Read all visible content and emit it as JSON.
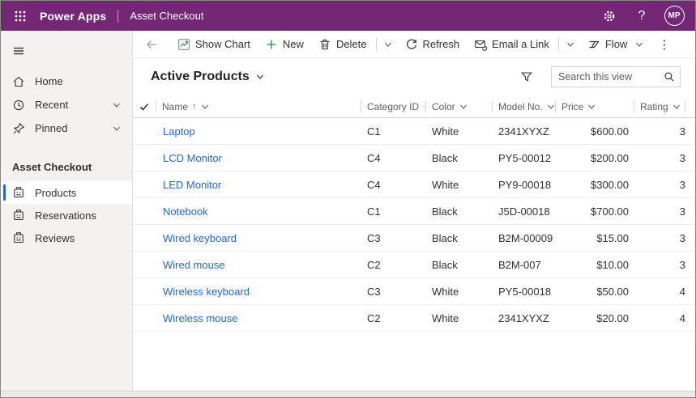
{
  "titlebar": {
    "app_name": "Power Apps",
    "app_context": "Asset Checkout",
    "avatar_initials": "MP",
    "background_color": "#742774"
  },
  "sidebar": {
    "nav": [
      {
        "label": "Home",
        "icon": "home-icon",
        "expandable": false
      },
      {
        "label": "Recent",
        "icon": "clock-icon",
        "expandable": true
      },
      {
        "label": "Pinned",
        "icon": "pin-icon",
        "expandable": true
      }
    ],
    "section_title": "Asset Checkout",
    "entities": [
      {
        "label": "Products",
        "icon": "product-icon",
        "selected": true
      },
      {
        "label": "Reservations",
        "icon": "product-icon",
        "selected": false
      },
      {
        "label": "Reviews",
        "icon": "product-icon",
        "selected": false
      }
    ]
  },
  "toolbar": {
    "show_chart_label": "Show Chart",
    "new_label": "New",
    "delete_label": "Delete",
    "refresh_label": "Refresh",
    "email_link_label": "Email a Link",
    "flow_label": "Flow",
    "more_glyph": "⋮",
    "new_plus_color": "#2E9C46"
  },
  "view": {
    "title": "Active Products",
    "search_placeholder": "Search this view"
  },
  "grid": {
    "columns": [
      {
        "label": "Name",
        "sorted": "ascending"
      },
      {
        "label": "Category ID"
      },
      {
        "label": "Color"
      },
      {
        "label": "Model No."
      },
      {
        "label": "Price"
      },
      {
        "label": "Rating"
      }
    ],
    "rows": [
      {
        "name": "Laptop",
        "category_id": "C1",
        "color": "White",
        "model_no": "2341XYXZ",
        "price": "$600.00",
        "rating": "3"
      },
      {
        "name": "LCD Monitor",
        "category_id": "C4",
        "color": "Black",
        "model_no": "PY5-00012",
        "price": "$200.00",
        "rating": "3"
      },
      {
        "name": "LED Monitor",
        "category_id": "C4",
        "color": "White",
        "model_no": "PY9-00018",
        "price": "$300.00",
        "rating": "3"
      },
      {
        "name": "Notebook",
        "category_id": "C1",
        "color": "Black",
        "model_no": "J5D-00018",
        "price": "$700.00",
        "rating": "3"
      },
      {
        "name": "Wired keyboard",
        "category_id": "C3",
        "color": "Black",
        "model_no": "B2M-00009",
        "price": "$15.00",
        "rating": "3"
      },
      {
        "name": "Wired mouse",
        "category_id": "C2",
        "color": "Black",
        "model_no": "B2M-007",
        "price": "$10.00",
        "rating": "3"
      },
      {
        "name": "Wireless keyboard",
        "category_id": "C3",
        "color": "White",
        "model_no": "PY5-00018",
        "price": "$50.00",
        "rating": "4"
      },
      {
        "name": "Wireless mouse",
        "category_id": "C2",
        "color": "White",
        "model_no": "2341XYXZ",
        "price": "$20.00",
        "rating": "4"
      }
    ],
    "sort_arrow_glyph": "↑"
  },
  "colors": {
    "accent_blue": "#2266E3",
    "link_blue": "#2266E3",
    "header_purple": "#742774"
  }
}
